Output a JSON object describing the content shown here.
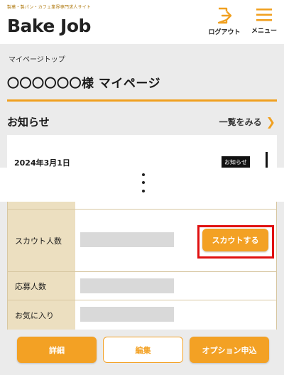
{
  "header": {
    "tagline": "製菓・製パン・カフェ業界専門求人サイト",
    "logo_text": "Bake Job",
    "logout_label": "ログアウト",
    "menu_label": "メニュー",
    "accent_color": "#f0a020",
    "icons": [
      "logout-icon",
      "hamburger-menu-icon"
    ]
  },
  "breadcrumb": "マイページトップ",
  "page_title": "〇〇〇〇〇〇様 マイページ",
  "news": {
    "heading": "お知らせ",
    "see_all_label": "一覧をみる",
    "see_all_icon": "chevron-right-icon",
    "items": [
      {
        "date": "2024年3月1日",
        "badge": "お知らせ"
      }
    ]
  },
  "stats": {
    "rows": [
      {
        "label": "スカウト人数"
      },
      {
        "label": "応募人数"
      },
      {
        "label": "お気に入り"
      }
    ],
    "scout_button_label": "スカウトする",
    "highlight_color": "#e01010"
  },
  "footer": {
    "detail_label": "詳細",
    "edit_label": "編集",
    "option_label": "オプション申込"
  }
}
